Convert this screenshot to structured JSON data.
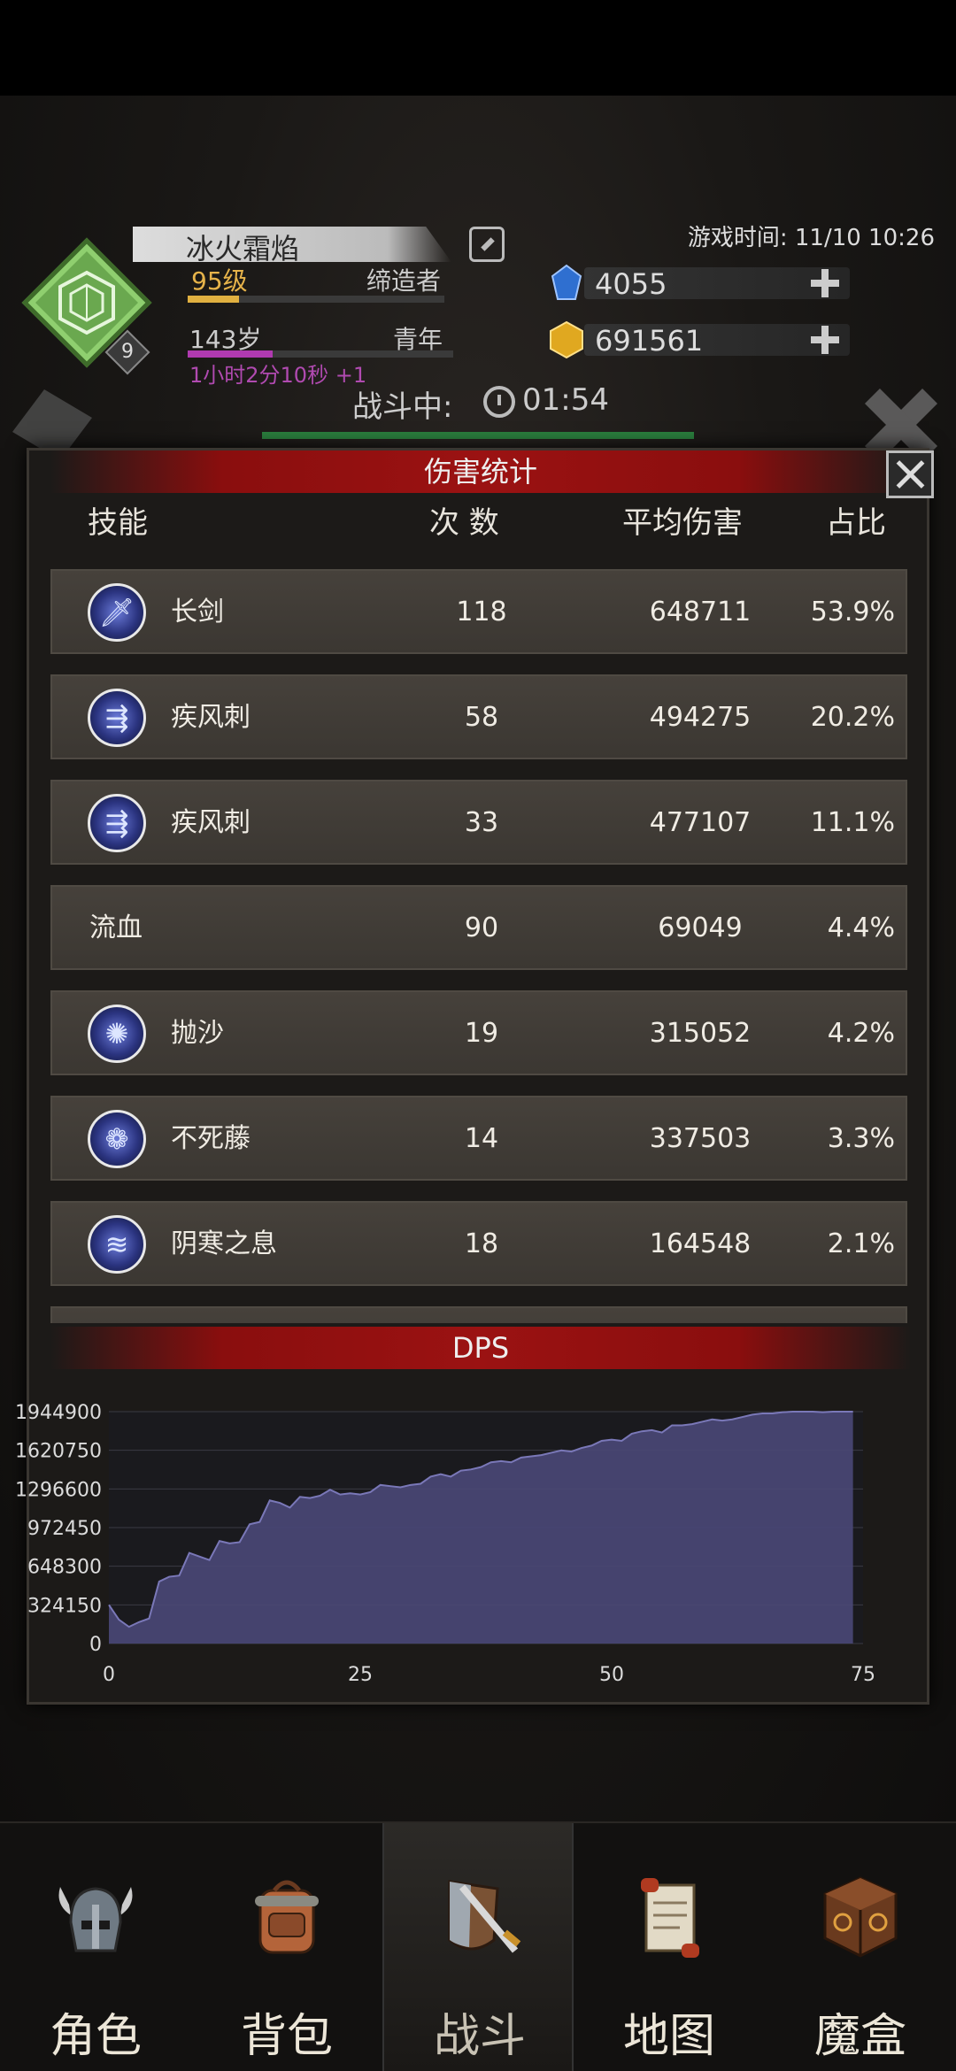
{
  "player": {
    "name": "冰火霜焰",
    "level": "95级",
    "title": "缔造者",
    "age": "143岁",
    "age_stage": "青年",
    "age_timer": "1小时2分10秒 +1",
    "rank_badge": "9",
    "xp_progress": 0.2,
    "age_progress": 0.32
  },
  "game_time": "游戏时间: 11/10 10:26",
  "resources": {
    "sapphire": "4055",
    "gold": "691561"
  },
  "battle": {
    "status_label": "战斗中:",
    "timer": "01:54"
  },
  "dialog": {
    "title": "伤害统计",
    "headers": {
      "skill": "技能",
      "count": "次 数",
      "avg": "平均伤害",
      "share": "占比"
    },
    "rows": [
      {
        "skill": "长剑",
        "icon": "sword-icon",
        "count": "118",
        "avg": "648711",
        "share": "53.9%"
      },
      {
        "skill": "疾风刺",
        "icon": "triple-arrow-icon",
        "count": "58",
        "avg": "494275",
        "share": "20.2%"
      },
      {
        "skill": "疾风刺",
        "icon": "triple-arrow-icon",
        "count": "33",
        "avg": "477107",
        "share": "11.1%"
      },
      {
        "skill": "流血",
        "icon": "",
        "count": "90",
        "avg": "69049",
        "share": "4.4%"
      },
      {
        "skill": "抛沙",
        "icon": "sand-throw-icon",
        "count": "19",
        "avg": "315052",
        "share": "4.2%"
      },
      {
        "skill": "不死藤",
        "icon": "vine-icon",
        "count": "14",
        "avg": "337503",
        "share": "3.3%"
      },
      {
        "skill": "阴寒之息",
        "icon": "frost-breath-icon",
        "count": "18",
        "avg": "164548",
        "share": "2.1%"
      }
    ],
    "dps_title": "DPS"
  },
  "chart_data": {
    "type": "area",
    "title": "DPS",
    "xlabel": "",
    "ylabel": "",
    "xlim": [
      0,
      75
    ],
    "ylim": [
      0,
      1944900
    ],
    "xticks": [
      "0",
      "25",
      "50",
      "75"
    ],
    "yticks": [
      "0",
      "324150",
      "648300",
      "972450",
      "1296600",
      "1620750",
      "1944900"
    ],
    "grid": true,
    "fill_color": "#4a4877",
    "line_color": "#7a78b8",
    "x": [
      0,
      1,
      2,
      3,
      4,
      5,
      6,
      7,
      8,
      9,
      10,
      11,
      12,
      13,
      14,
      15,
      16,
      17,
      18,
      19,
      20,
      21,
      22,
      23,
      24,
      25,
      26,
      27,
      28,
      29,
      30,
      31,
      32,
      33,
      34,
      35,
      36,
      37,
      38,
      39,
      40,
      41,
      42,
      43,
      44,
      45,
      46,
      47,
      48,
      49,
      50,
      51,
      52,
      53,
      54,
      55,
      56,
      57,
      58,
      59,
      60,
      61,
      62,
      63,
      64,
      65,
      66,
      67,
      68,
      69,
      70,
      71,
      72,
      73,
      74
    ],
    "y": [
      324150,
      200000,
      140000,
      180000,
      210000,
      520000,
      560000,
      570000,
      760000,
      730000,
      700000,
      860000,
      840000,
      850000,
      1000000,
      1020000,
      1200000,
      1180000,
      1140000,
      1230000,
      1220000,
      1240000,
      1290000,
      1250000,
      1260000,
      1250000,
      1270000,
      1330000,
      1320000,
      1310000,
      1330000,
      1340000,
      1400000,
      1420000,
      1400000,
      1450000,
      1460000,
      1480000,
      1520000,
      1530000,
      1520000,
      1560000,
      1570000,
      1580000,
      1600000,
      1620000,
      1610000,
      1640000,
      1660000,
      1700000,
      1710000,
      1700000,
      1760000,
      1780000,
      1790000,
      1770000,
      1830000,
      1830000,
      1840000,
      1860000,
      1880000,
      1870000,
      1880000,
      1900000,
      1920000,
      1930000,
      1930000,
      1940000,
      1944900,
      1944900,
      1944900,
      1940000,
      1944900,
      1944900,
      1944900
    ]
  },
  "nav": [
    {
      "label": "角色",
      "icon": "helmet-icon"
    },
    {
      "label": "背包",
      "icon": "backpack-icon"
    },
    {
      "label": "战斗",
      "icon": "sword-shield-icon"
    },
    {
      "label": "地图",
      "icon": "scroll-map-icon"
    },
    {
      "label": "魔盒",
      "icon": "magic-box-icon"
    }
  ],
  "nav_active": "战斗"
}
